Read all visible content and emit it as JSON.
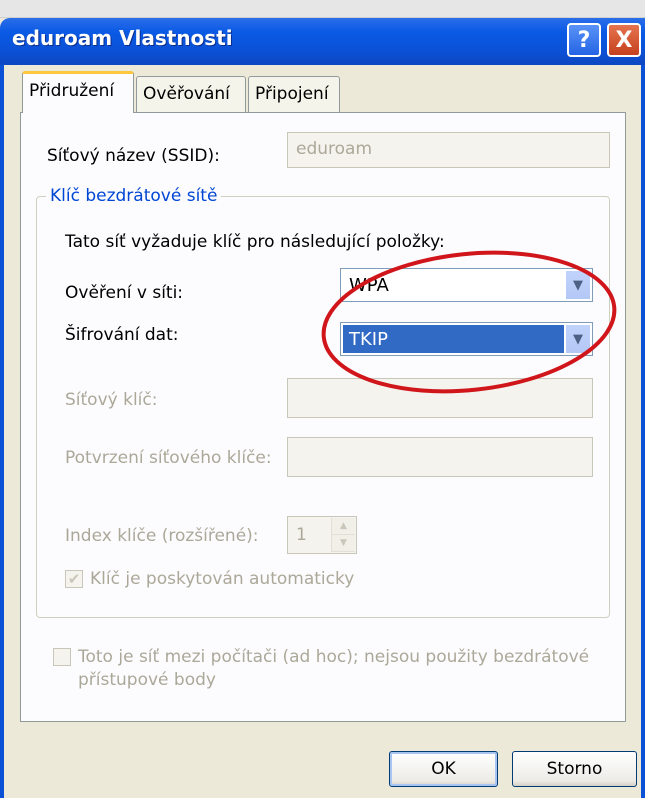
{
  "window": {
    "title": "eduroam Vlastnosti",
    "help_label": "?",
    "close_label": "X"
  },
  "tabs": [
    {
      "label": "Přidružení",
      "active": true
    },
    {
      "label": "Ověřování",
      "active": false
    },
    {
      "label": "Připojení",
      "active": false
    }
  ],
  "ssid": {
    "label": "Síťový název (SSID):",
    "value": "eduroam"
  },
  "wireless_key_group": {
    "legend": "Klíč bezdrátové sítě",
    "intro": "Tato síť vyžaduje klíč pro následující položky:",
    "auth_label": "Ověření v síti:",
    "auth_value": "WPA",
    "encryption_label": "Šifrování dat:",
    "encryption_value": "TKIP",
    "network_key_label": "Síťový klíč:",
    "network_key_value": "",
    "confirm_key_label": "Potvrzení síťového klíče:",
    "confirm_key_value": "",
    "key_index_label": "Index klíče (rozšířené):",
    "key_index_value": "1",
    "auto_key_label": "Klíč je poskytován automaticky",
    "auto_key_checked": true
  },
  "adhoc": {
    "label_line1": "Toto je síť mezi počítači (ad hoc); nejsou použity bezdrátové",
    "label_line2": "přístupové body",
    "checked": false
  },
  "buttons": {
    "ok": "OK",
    "cancel": "Storno"
  },
  "colors": {
    "titlebar": "#0b51d6",
    "selection": "#316ac5",
    "annotation": "#d0161b",
    "tab_highlight": "#ffc83c"
  }
}
